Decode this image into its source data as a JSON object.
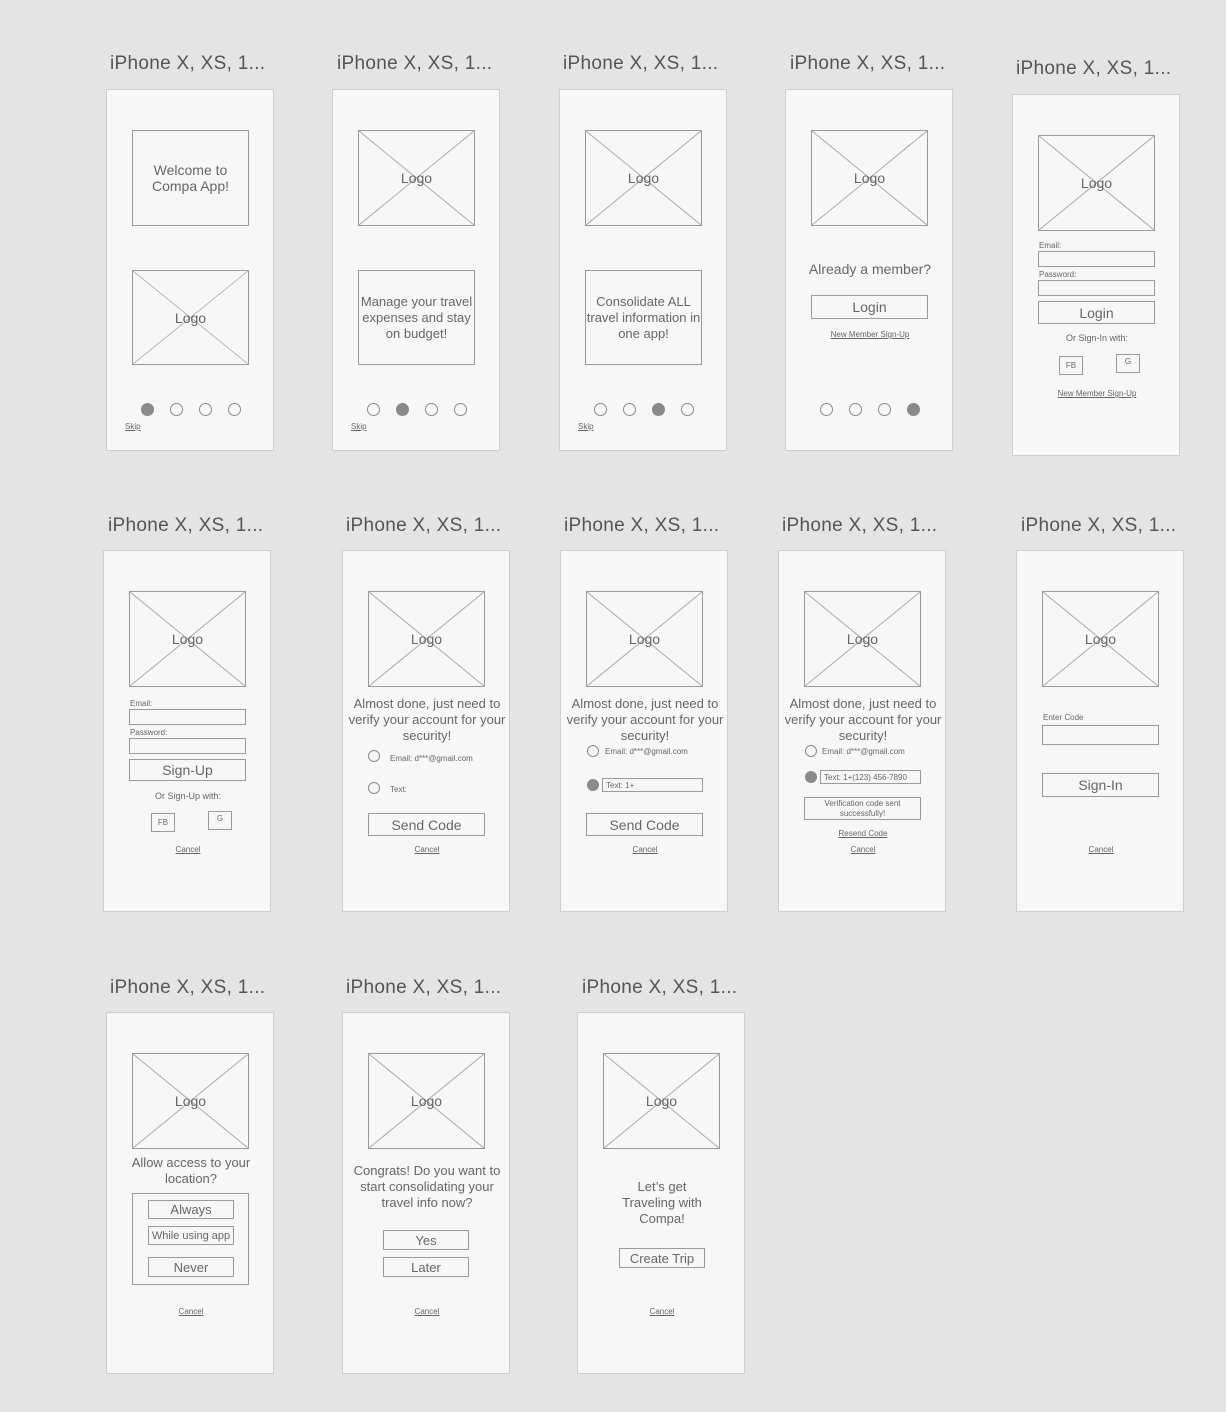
{
  "frames": {
    "title": "iPhone X, XS, 1...",
    "logo": "Logo",
    "skip": "Skip",
    "cancel": "Cancel",
    "new_member": "New Member Sign-Up",
    "email_label": "Email:",
    "password_label": "Password:",
    "fb": "FB",
    "g": "G"
  },
  "f1": {
    "welcome": "Welcome to Compa App!"
  },
  "f2": {
    "text": "Manage your travel expenses and stay on budget!"
  },
  "f3": {
    "text": "Consolidate ALL travel information in one app!"
  },
  "f4": {
    "heading": "Already a member?",
    "login": "Login"
  },
  "f5": {
    "login": "Login",
    "or": "Or Sign-In with:"
  },
  "f6": {
    "signup": "Sign-Up",
    "or": "Or Sign-Up with:"
  },
  "verify": {
    "heading": "Almost done, just need to verify your account for your security!",
    "email_opt": "Email: d***@gmail.com",
    "text_opt": "Text:",
    "text_opt_value": "Text: 1+",
    "text_opt_full": "Text: 1+(123) 456-7890",
    "send": "Send Code",
    "sent": "Verification code sent successfully!",
    "resend": "Resend Code"
  },
  "f10": {
    "enter_code": "Enter Code",
    "signin": "Sign-In"
  },
  "f11": {
    "heading": "Allow access to your location?",
    "always": "Always",
    "while": "While using app",
    "never": "Never"
  },
  "f12": {
    "heading": "Congrats! Do you want to start consolidating your travel info now?",
    "yes": "Yes",
    "later": "Later"
  },
  "f13": {
    "heading": "Let’s get Traveling with Compa!",
    "create": "Create Trip"
  }
}
